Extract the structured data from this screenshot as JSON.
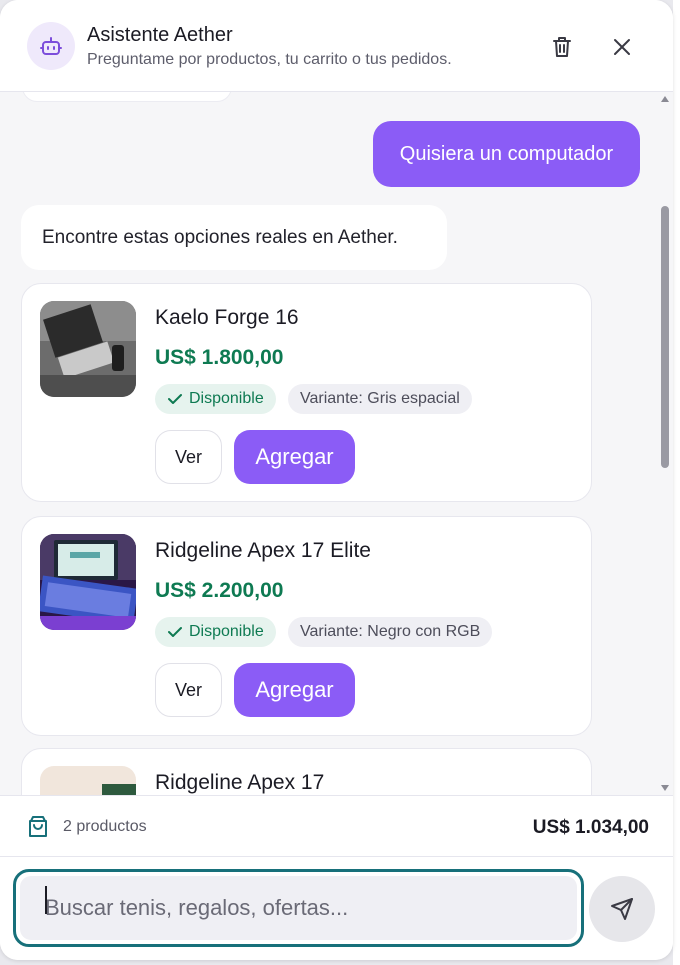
{
  "header": {
    "title": "Asistente Aether",
    "subtitle": "Preguntame por productos, tu carrito o tus pedidos.",
    "avatar_icon": "robot-icon",
    "delete_icon": "trash-icon",
    "close_icon": "close-icon"
  },
  "messages": {
    "user": "Quisiera un computador",
    "bot": "Encontre estas opciones reales en Aether."
  },
  "products": [
    {
      "name": "Kaelo Forge 16",
      "price": "US$ 1.800,00",
      "status": "Disponible",
      "variant": "Variante: Gris espacial",
      "view_label": "Ver",
      "add_label": "Agregar"
    },
    {
      "name": "Ridgeline Apex 17 Elite",
      "price": "US$ 2.200,00",
      "status": "Disponible",
      "variant": "Variante: Negro con RGB",
      "view_label": "Ver",
      "add_label": "Agregar"
    },
    {
      "name": "Ridgeline Apex 17"
    }
  ],
  "cart": {
    "count": "2 productos",
    "total": "US$ 1.034,00",
    "icon": "shopping-bag-icon"
  },
  "input": {
    "placeholder": "Buscar tenis, regalos, ofertas...",
    "value": "",
    "send_icon": "send-icon"
  },
  "colors": {
    "accent": "#8b5cf6",
    "price": "#0e7a52",
    "focus_border": "#17707a"
  }
}
